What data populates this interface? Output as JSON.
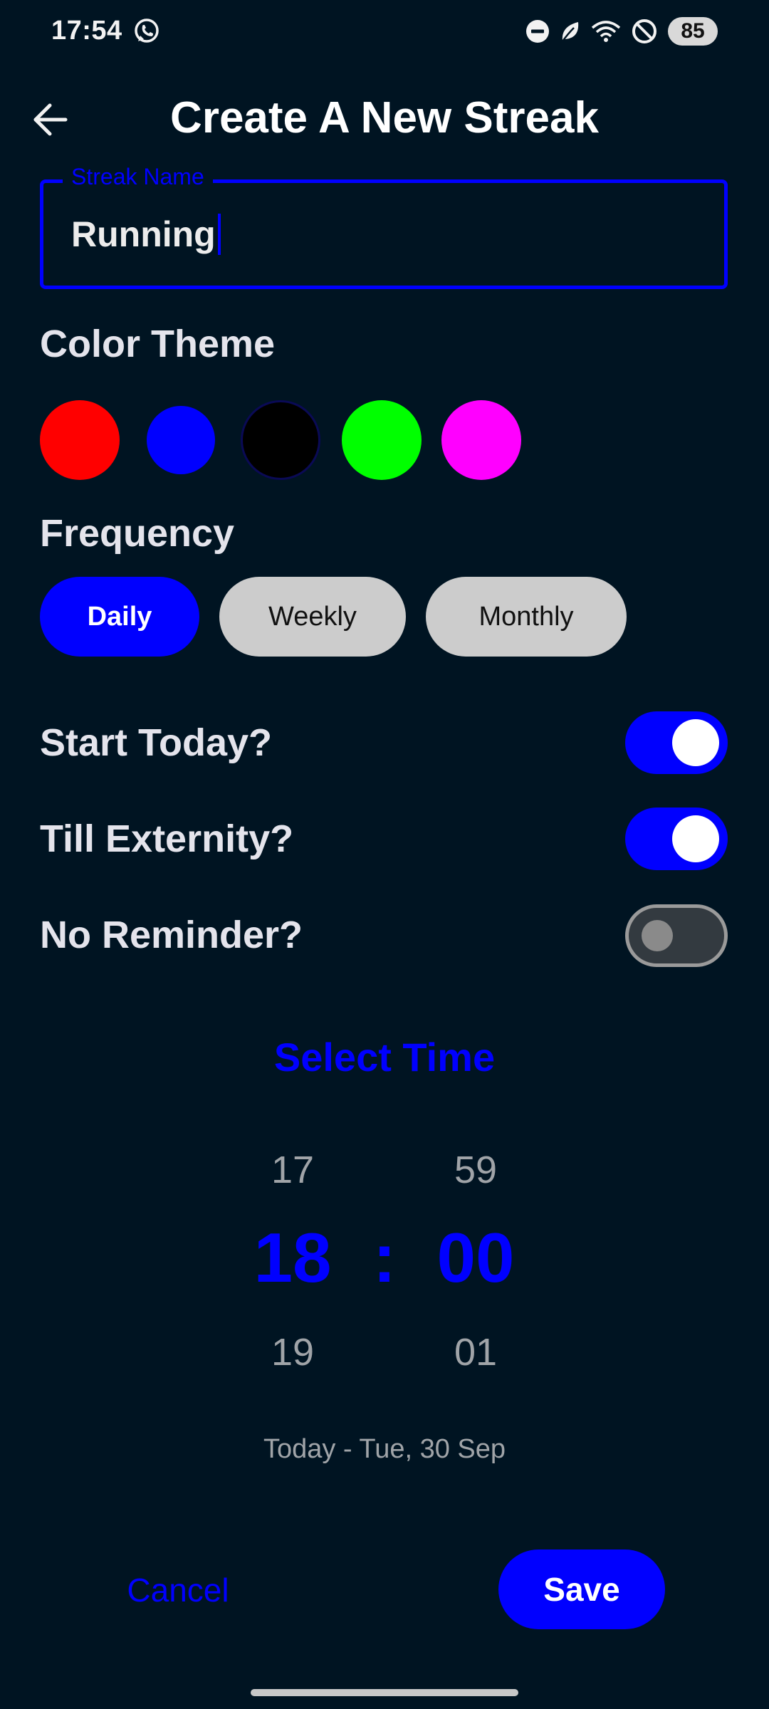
{
  "status_bar": {
    "time": "17:54",
    "battery": "85",
    "icons": [
      "whatsapp-icon",
      "dnd-icon",
      "leaf-icon",
      "wifi-icon",
      "no-signal-icon",
      "battery-icon"
    ]
  },
  "header": {
    "title": "Create A New Streak",
    "back_icon": "arrow-left-icon"
  },
  "streak_name": {
    "label": "Streak Name",
    "value": "Running"
  },
  "color_theme": {
    "heading": "Color Theme",
    "colors": [
      "#ff0000",
      "#0000ff",
      "#000000",
      "#00ff00",
      "#ff00ff"
    ],
    "selected": "#0000ff"
  },
  "frequency": {
    "heading": "Frequency",
    "options": [
      "Daily",
      "Weekly",
      "Monthly"
    ],
    "selected": "Daily"
  },
  "toggles": [
    {
      "label": "Start Today?",
      "on": true
    },
    {
      "label": "Till Externity?",
      "on": true
    },
    {
      "label": "No Reminder?",
      "on": false
    }
  ],
  "time_picker": {
    "heading": "Select Time",
    "hour_prev": "17",
    "hour": "18",
    "hour_next": "19",
    "separator": ":",
    "minute_prev": "59",
    "minute": "00",
    "minute_next": "01",
    "date_caption": "Today - Tue, 30 Sep"
  },
  "actions": {
    "cancel_label": "Cancel",
    "save_label": "Save"
  },
  "theme": {
    "accent": "#0000ff",
    "background": "#001422"
  }
}
